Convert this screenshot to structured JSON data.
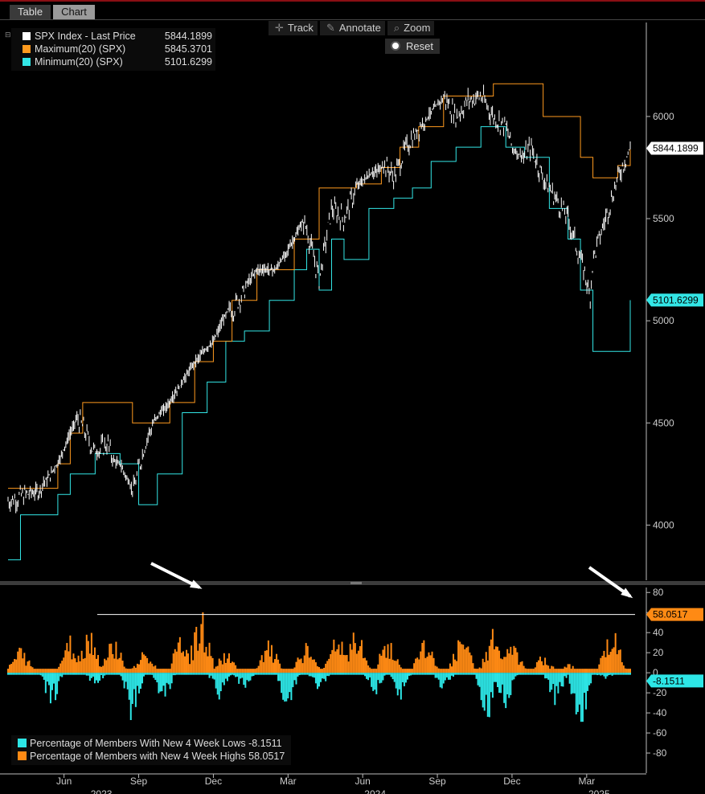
{
  "tabs": [
    {
      "label": "Table"
    },
    {
      "label": "Chart"
    }
  ],
  "toolbar": {
    "track": "Track",
    "annotate": "Annotate",
    "zoom": "Zoom",
    "reset": "Reset"
  },
  "colors": {
    "price": "#ffffff",
    "max": "#ff9a1e",
    "min": "#33e6e6",
    "highs": "#ff8a14",
    "lows": "#2de6e6"
  },
  "upper_legend": [
    {
      "name": "SPX Index - Last Price",
      "value": "5844.1899",
      "color": "#ffffff"
    },
    {
      "name": "Maximum(20) (SPX)",
      "value": "5845.3701",
      "color": "#ff9a1e"
    },
    {
      "name": "Minimum(20) (SPX)",
      "value": "5101.6299",
      "color": "#33e6e6"
    }
  ],
  "lower_legend": [
    {
      "name": "Percentage of Members With New 4 Week Lows",
      "value": "-8.1511",
      "color": "#2de6e6"
    },
    {
      "name": "Percentage of Members with New 4 Week Highs",
      "value": "58.0517",
      "color": "#ff8a14"
    }
  ],
  "chart_data": [
    {
      "type": "line",
      "y_ticks": [
        "4000",
        "4500",
        "5000",
        "5500",
        "6000"
      ],
      "ylim": [
        3730,
        6460
      ],
      "value_tags": [
        {
          "text": "5844.1899",
          "value": 5844.19,
          "series": "price"
        },
        {
          "text": "5101.6299",
          "value": 5101.63,
          "series": "min"
        }
      ],
      "series": [
        {
          "name": "SPX Index - Last Price",
          "key": "price",
          "x": [
            0,
            0.03,
            0.05,
            0.07,
            0.09,
            0.1,
            0.12,
            0.14,
            0.16,
            0.18,
            0.2,
            0.22,
            0.24,
            0.26,
            0.28,
            0.3,
            0.32,
            0.34,
            0.36,
            0.38,
            0.4,
            0.42,
            0.44,
            0.46,
            0.48,
            0.5,
            0.52,
            0.54,
            0.56,
            0.58,
            0.6,
            0.62,
            0.64,
            0.66,
            0.68,
            0.7,
            0.72,
            0.74,
            0.76,
            0.78,
            0.8,
            0.82,
            0.84,
            0.86,
            0.88,
            0.9,
            0.91,
            0.92,
            0.93,
            0.935,
            0.94,
            0.945,
            0.95,
            0.96,
            0.97,
            0.975,
            0.98,
            0.99,
            1.0
          ],
          "values": [
            4120,
            4150,
            4180,
            4280,
            4450,
            4580,
            4480,
            4350,
            4400,
            4200,
            4150,
            4400,
            4550,
            4800,
            4750,
            4950,
            5100,
            5220,
            5050,
            5150,
            5300,
            5480,
            5550,
            5600,
            5450,
            5200,
            5550,
            5500,
            5650,
            5750,
            5800,
            5700,
            5850,
            5950,
            6050,
            6100,
            6000,
            6080,
            6100,
            6000,
            5950,
            5750,
            5850,
            5700,
            5600,
            5500,
            5400,
            5300,
            5200,
            5100,
            5300,
            5350,
            5400,
            5500,
            5600,
            5650,
            5700,
            5780,
            5844
          ]
        },
        {
          "name": "Maximum(20) (SPX)",
          "key": "max",
          "x": [
            0,
            0.05,
            0.08,
            0.1,
            0.12,
            0.15,
            0.2,
            0.23,
            0.26,
            0.3,
            0.33,
            0.36,
            0.4,
            0.43,
            0.46,
            0.5,
            0.53,
            0.56,
            0.6,
            0.63,
            0.66,
            0.7,
            0.73,
            0.78,
            0.82,
            0.86,
            0.9,
            0.92,
            0.94,
            0.96,
            0.98,
            1.0
          ],
          "values": [
            4180,
            4180,
            4300,
            4450,
            4600,
            4600,
            4500,
            4500,
            4600,
            4800,
            4900,
            5100,
            5250,
            5250,
            5400,
            5650,
            5650,
            5670,
            5750,
            5850,
            5950,
            6100,
            6100,
            6160,
            6160,
            6000,
            6000,
            5800,
            5700,
            5700,
            5760,
            5845
          ]
        },
        {
          "name": "Minimum(20) (SPX)",
          "key": "min",
          "x": [
            0,
            0.02,
            0.05,
            0.08,
            0.1,
            0.14,
            0.18,
            0.21,
            0.24,
            0.28,
            0.32,
            0.35,
            0.38,
            0.42,
            0.46,
            0.48,
            0.5,
            0.52,
            0.54,
            0.58,
            0.62,
            0.65,
            0.68,
            0.72,
            0.76,
            0.8,
            0.83,
            0.87,
            0.9,
            0.92,
            0.94,
            0.96,
            0.98,
            1.0
          ],
          "values": [
            3830,
            4050,
            4050,
            4150,
            4250,
            4350,
            4300,
            4100,
            4250,
            4550,
            4700,
            4900,
            4950,
            5100,
            5250,
            5350,
            5150,
            5400,
            5300,
            5550,
            5600,
            5650,
            5780,
            5850,
            5950,
            5850,
            5800,
            5550,
            5400,
            5150,
            4850,
            4850,
            4850,
            5101
          ]
        }
      ]
    },
    {
      "type": "bar",
      "y_ticks": [
        "80",
        "60",
        "40",
        "20",
        "0",
        "-20",
        "-40",
        "-60",
        "-80"
      ],
      "ylim": [
        -100,
        85
      ],
      "x_ticks": [
        "Jun",
        "Sep",
        "Dec",
        "Mar",
        "Jun",
        "Sep",
        "Dec",
        "Mar"
      ],
      "year_labels": [
        "2023",
        "2024",
        "2025"
      ],
      "reference_line": 58.0517,
      "value_tags": [
        {
          "text": "58.0517",
          "value": 58.0517,
          "series": "highs"
        },
        {
          "text": "-8.1511",
          "value": -8.1511,
          "series": "lows"
        }
      ],
      "series": [
        {
          "name": "Percentage of Members with New 4 Week Highs",
          "key": "highs",
          "peaks": [
            {
              "x": 0.02,
              "v": 30
            },
            {
              "x": 0.1,
              "v": 40
            },
            {
              "x": 0.13,
              "v": 55
            },
            {
              "x": 0.17,
              "v": 42
            },
            {
              "x": 0.22,
              "v": 25
            },
            {
              "x": 0.28,
              "v": 45
            },
            {
              "x": 0.31,
              "v": 70
            },
            {
              "x": 0.35,
              "v": 25
            },
            {
              "x": 0.42,
              "v": 35
            },
            {
              "x": 0.48,
              "v": 35
            },
            {
              "x": 0.53,
              "v": 45
            },
            {
              "x": 0.56,
              "v": 50
            },
            {
              "x": 0.61,
              "v": 40
            },
            {
              "x": 0.67,
              "v": 40
            },
            {
              "x": 0.73,
              "v": 45
            },
            {
              "x": 0.78,
              "v": 50
            },
            {
              "x": 0.81,
              "v": 35
            },
            {
              "x": 0.86,
              "v": 20
            },
            {
              "x": 0.9,
              "v": 10
            },
            {
              "x": 0.97,
              "v": 58
            }
          ]
        },
        {
          "name": "Percentage of Members With New 4 Week Lows",
          "key": "lows",
          "troughs": [
            {
              "x": 0.07,
              "v": -40
            },
            {
              "x": 0.14,
              "v": -15
            },
            {
              "x": 0.2,
              "v": -55
            },
            {
              "x": 0.25,
              "v": -35
            },
            {
              "x": 0.34,
              "v": -30
            },
            {
              "x": 0.38,
              "v": -20
            },
            {
              "x": 0.45,
              "v": -45
            },
            {
              "x": 0.5,
              "v": -20
            },
            {
              "x": 0.59,
              "v": -25
            },
            {
              "x": 0.63,
              "v": -30
            },
            {
              "x": 0.7,
              "v": -20
            },
            {
              "x": 0.77,
              "v": -70
            },
            {
              "x": 0.8,
              "v": -45
            },
            {
              "x": 0.88,
              "v": -40
            },
            {
              "x": 0.92,
              "v": -85
            },
            {
              "x": 0.96,
              "v": -8
            }
          ]
        }
      ]
    }
  ]
}
